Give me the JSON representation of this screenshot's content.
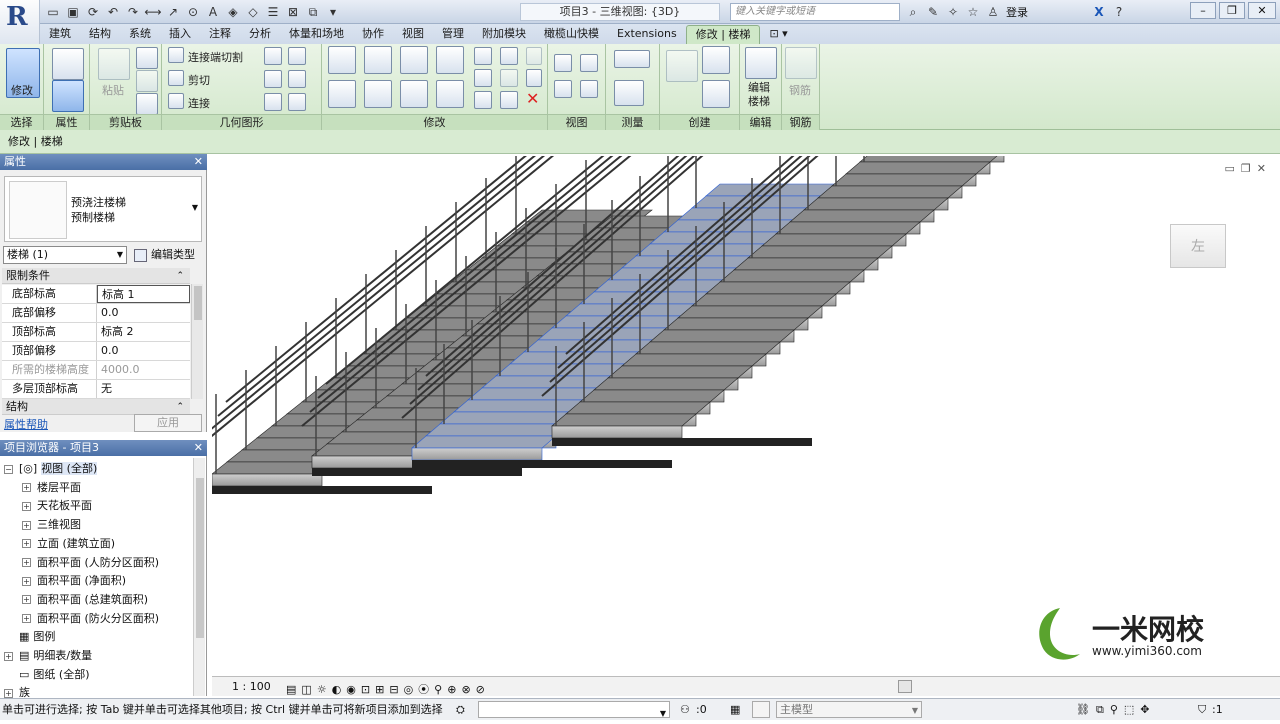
{
  "titlebar": {
    "doc_title": "项目3 - 三维视图: {3D}",
    "search_placeholder": "键入关键字或短语",
    "login": "登录"
  },
  "tabs": [
    "建筑",
    "结构",
    "系统",
    "插入",
    "注释",
    "分析",
    "体量和场地",
    "协作",
    "视图",
    "管理",
    "附加模块",
    "橄榄山快模",
    "Extensions",
    "修改 | 楼梯"
  ],
  "ribbon": {
    "select": {
      "modify": "修改",
      "label": "选择"
    },
    "properties": {
      "label": "属性"
    },
    "clipboard": {
      "paste": "粘贴",
      "label": "剪贴板"
    },
    "geometry": {
      "join_cut": "连接端切割",
      "cut": "剪切",
      "join": "连接",
      "label": "几何图形"
    },
    "modify": {
      "label": "修改"
    },
    "view": {
      "label": "视图"
    },
    "measure": {
      "label": "测量"
    },
    "create": {
      "label": "创建"
    },
    "edit": {
      "edit_stairs": "编辑\n楼梯",
      "label": "编辑"
    },
    "rebar": {
      "rebar": "钢筋",
      "label": "钢筋"
    }
  },
  "options_bar": "修改 | 楼梯",
  "properties": {
    "title": "属性",
    "type_family": "预浇注楼梯",
    "type_name": "预制楼梯",
    "instance_selector": "楼梯 (1)",
    "edit_type": "编辑类型",
    "group_constraints": "限制条件",
    "group_structure": "结构",
    "rows": [
      {
        "key": "底部标高",
        "value": "标高 1"
      },
      {
        "key": "底部偏移",
        "value": "0.0"
      },
      {
        "key": "顶部标高",
        "value": "标高 2"
      },
      {
        "key": "顶部偏移",
        "value": "0.0"
      },
      {
        "key": "所需的楼梯高度",
        "value": "4000.0"
      },
      {
        "key": "多层顶部标高",
        "value": "无"
      }
    ],
    "help": "属性帮助",
    "apply": "应用"
  },
  "browser": {
    "title": "项目浏览器 - 项目3",
    "nodes": [
      {
        "label": "视图 (全部)",
        "pm": "−"
      },
      {
        "label": "楼层平面",
        "pm": "+"
      },
      {
        "label": "天花板平面",
        "pm": "+"
      },
      {
        "label": "三维视图",
        "pm": "+"
      },
      {
        "label": "立面 (建筑立面)",
        "pm": "+"
      },
      {
        "label": "面积平面 (人防分区面积)",
        "pm": "+"
      },
      {
        "label": "面积平面 (净面积)",
        "pm": "+"
      },
      {
        "label": "面积平面 (总建筑面积)",
        "pm": "+"
      },
      {
        "label": "面积平面 (防火分区面积)",
        "pm": "+"
      },
      {
        "label": "图例",
        "pm": ""
      },
      {
        "label": "明细表/数量",
        "pm": "+"
      },
      {
        "label": "图纸 (全部)",
        "pm": ""
      },
      {
        "label": "族",
        "pm": "+"
      }
    ]
  },
  "viewport": {
    "viewcube_face": "左",
    "scale": "1 : 100",
    "watermark_brand": "一米网校",
    "watermark_url": "www.yimi360.com"
  },
  "status": {
    "message": "单击可进行选择; 按 Tab 键并单击可选择其他项目; 按 Ctrl 键并单击可将新项目添加到选择",
    "count": ":0",
    "model": "主模型",
    "filter_count": ":1"
  },
  "colors": {
    "ribbon_green": "#d3e8cc",
    "panel_header": "#4a6fa6",
    "selection_blue": "#2b5fd6"
  }
}
